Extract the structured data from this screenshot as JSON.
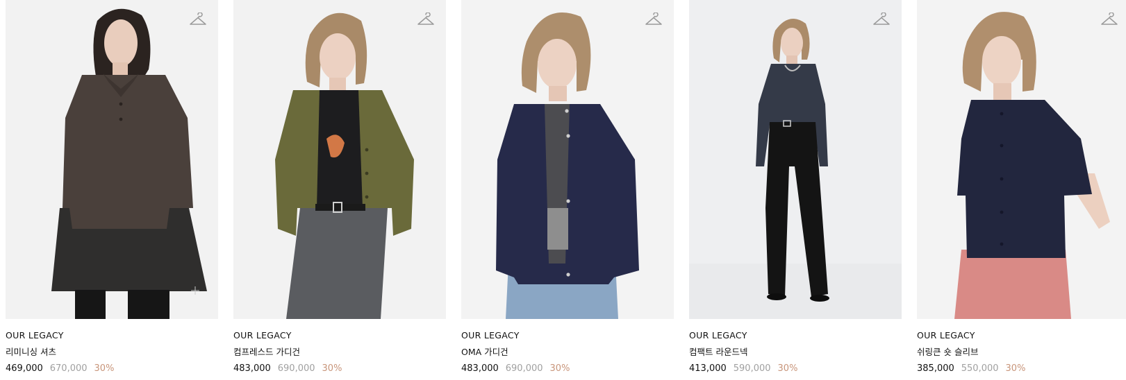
{
  "products": [
    {
      "brand": "OUR LEGACY",
      "name": "리미니싱 셔츠",
      "price": "469,000",
      "original_price": "670,000",
      "discount": "30%",
      "icon": "hanger-icon"
    },
    {
      "brand": "OUR LEGACY",
      "name": "컴프레스드 가디건",
      "price": "483,000",
      "original_price": "690,000",
      "discount": "30%",
      "icon": "hanger-icon"
    },
    {
      "brand": "OUR LEGACY",
      "name": "OMA 가디건",
      "price": "483,000",
      "original_price": "690,000",
      "discount": "30%",
      "icon": "hanger-icon"
    },
    {
      "brand": "OUR LEGACY",
      "name": "컴팩트 라운드넥",
      "price": "413,000",
      "original_price": "590,000",
      "discount": "30%",
      "icon": "hanger-icon"
    },
    {
      "brand": "OUR LEGACY",
      "name": "쉬링큰 숏 슬리브",
      "price": "385,000",
      "original_price": "550,000",
      "discount": "30%",
      "icon": "hanger-icon"
    }
  ],
  "colors": {
    "photo_background": "#f1f1f1",
    "text": "#111111",
    "original_price": "#a0a0a0",
    "discount": "#c8957a"
  }
}
